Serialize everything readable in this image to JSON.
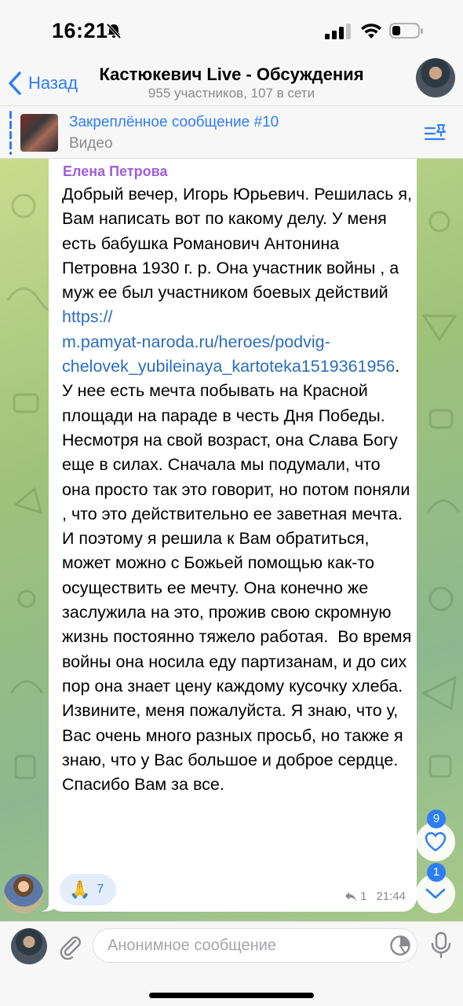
{
  "status_bar": {
    "time": "16:21"
  },
  "header": {
    "back_label": "Назад",
    "title": "Кастюкевич Live - Обсуждения",
    "subtitle": "955 участников, 107 в сети"
  },
  "pinned": {
    "title": "Закреплённое сообщение #10",
    "subtitle": "Видео"
  },
  "message": {
    "sender": "Елена Петрова",
    "text_before_link": "Добрый вечер, Игорь Юрьевич. Решилась я, Вам написать вот по какому делу. У меня есть бабушка Романович Антонина Петровна 1930 г. р. Она участник войны , а муж ее был участником боевых действий ",
    "link": "https://\nm.pamyat-naroda.ru/heroes/podvig-chelovek_yubileinaya_kartoteka1519361956",
    "text_after_link": ".\nУ нее есть мечта побывать на Красной площади на параде в честь Дня Победы. Несмотря на свой возраст, она Слава Богу еще в силах. Сначала мы подумали, что она просто так это говорит, но потом поняли , что это действительно ее заветная мечта. И поэтому я решила к Вам обратиться, может можно с Божьей помощью как-то осуществить ее мечту. Она конечно же заслужила на это, прожив свою скромную жизнь постоянно тяжело работая.  Во время войны она носила еду партизанам, и до сих пор она знает цену каждому кусочку хлеба.\nИзвините, меня пожалуйста. Я знаю, что у, Вас очень много разных просьб, но также я знаю, что у Вас большое и доброе сердце. Спасибо Вам за все.",
    "reaction_emoji": "🙏",
    "reaction_count": "7",
    "reply_count": "1",
    "time": "21:44"
  },
  "floating": {
    "reactions_badge": "9",
    "unread_badge": "1"
  },
  "input": {
    "placeholder": "Анонимное сообщение"
  },
  "colors": {
    "accent": "#2f7df6",
    "sender_name": "#a05ed8",
    "link": "#2b6dbf"
  }
}
